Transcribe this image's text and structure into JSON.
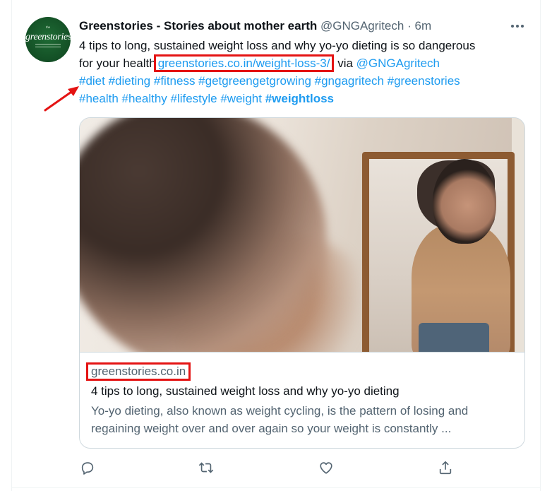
{
  "tweet": {
    "author_name": "Greenstories - Stories about mother earth",
    "handle": "@GNGAgritech",
    "separator": "·",
    "time": "6m",
    "avatar_logo": "greenstories",
    "text": {
      "line1": "4 tips to long, sustained weight loss and why yo-yo dieting is so dangerous",
      "line2_prefix": "for your health",
      "url": "greenstories.co.in/weight-loss-3/",
      "via": " via ",
      "via_handle": "@GNGAgritech",
      "hashtags_line1": "#diet #dieting #fitness #getgreengetgrowing #gngagritech #greenstories",
      "hashtags_line2": "#health #healthy #lifestyle #weight ",
      "hashtag_bold": "#weightloss"
    }
  },
  "card": {
    "domain": "greenstories.co.in",
    "title": "4 tips to long, sustained weight loss and why yo-yo dieting",
    "description": "Yo-yo dieting, also known as weight cycling, is the pattern of losing and regaining weight over and over again so your weight is constantly ..."
  },
  "icons": {
    "more": "more-dots-icon",
    "reply": "reply-icon",
    "retweet": "retweet-icon",
    "like": "like-icon",
    "share": "share-icon"
  },
  "colors": {
    "link": "#1d9bf0",
    "secondary_text": "#536471",
    "highlight_box": "#e41313",
    "annotation_arrow": "#e41313"
  }
}
